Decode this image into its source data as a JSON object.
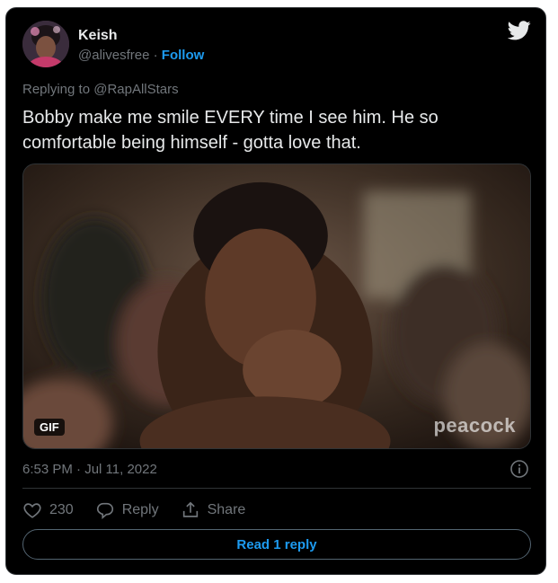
{
  "author": {
    "name": "Keish",
    "handle": "@alivesfree",
    "separator": "·",
    "follow_label": "Follow"
  },
  "replying": {
    "prefix": "Replying to",
    "mention": "@RapAllStars"
  },
  "tweet": {
    "text": "Bobby make me smile EVERY time I see him. He so comfortable being himself - gotta love that."
  },
  "media": {
    "badge": "GIF",
    "watermark": "peacock"
  },
  "meta": {
    "timestamp": "6:53 PM · Jul 11, 2022"
  },
  "actions": {
    "like_count": "230",
    "reply_label": "Reply",
    "share_label": "Share"
  },
  "read_reply_label": "Read 1 reply",
  "colors": {
    "accent": "#1d9bf0",
    "background": "#000000",
    "text": "#e7e9ea",
    "muted": "#71767b",
    "border": "#2f3336"
  },
  "icons": [
    "twitter-bird-icon",
    "info-icon",
    "heart-icon",
    "reply-bubble-icon",
    "share-icon"
  ]
}
